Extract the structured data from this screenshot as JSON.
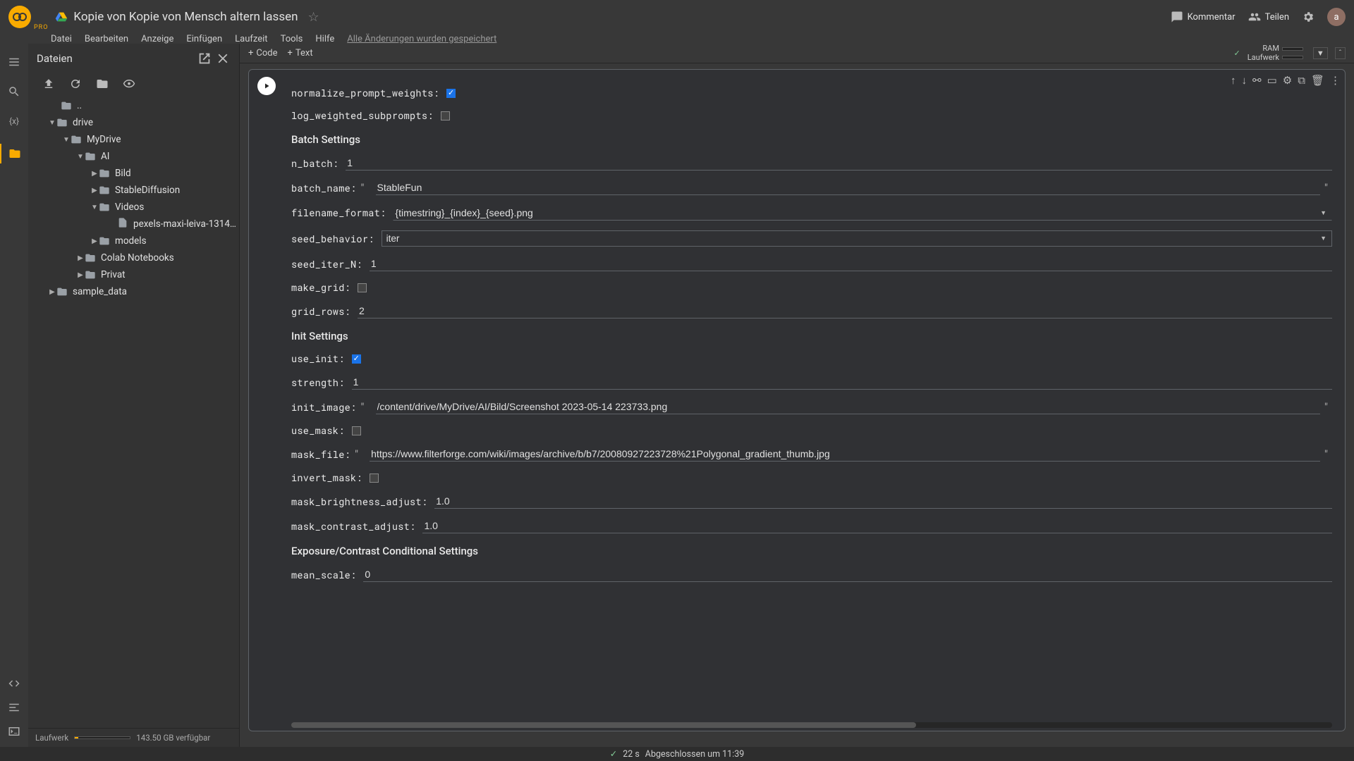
{
  "header": {
    "pro": "PRO",
    "title": "Kopie von Kopie von Mensch altern lassen",
    "comment": "Kommentar",
    "share": "Teilen",
    "avatar": "a"
  },
  "menu": {
    "items": [
      "Datei",
      "Bearbeiten",
      "Anzeige",
      "Einfügen",
      "Laufzeit",
      "Tools",
      "Hilfe"
    ],
    "saved": "Alle Änderungen wurden gespeichert"
  },
  "sidebar": {
    "title": "Dateien",
    "tree": {
      "dots": "..",
      "drive": "drive",
      "mydrive": "MyDrive",
      "ai": "AI",
      "bild": "Bild",
      "sd": "StableDiffusion",
      "videos": "Videos",
      "video_file": "pexels-maxi-leiva-1314…",
      "models": "models",
      "colab": "Colab Notebooks",
      "privat": "Privat",
      "sample": "sample_data"
    },
    "footer_label": "Laufwerk",
    "footer_free": "143.50 GB verfügbar"
  },
  "toolbar": {
    "code": "Code",
    "text": "Text",
    "ram": "RAM",
    "runtime": "Laufwerk"
  },
  "form": {
    "normalize_prompt_weights": {
      "label": "normalize_prompt_weights:",
      "value": true
    },
    "log_weighted_subprompts": {
      "label": "log_weighted_subprompts:",
      "value": false
    },
    "batch_heading": "Batch Settings",
    "n_batch": {
      "label": "n_batch:",
      "value": "1"
    },
    "batch_name": {
      "label": "batch_name:",
      "value": "StableFun"
    },
    "filename_format": {
      "label": "filename_format:",
      "value": "{timestring}_{index}_{seed}.png"
    },
    "seed_behavior": {
      "label": "seed_behavior:",
      "value": "iter"
    },
    "seed_iter_N": {
      "label": "seed_iter_N:",
      "value": "1"
    },
    "make_grid": {
      "label": "make_grid:",
      "value": false
    },
    "grid_rows": {
      "label": "grid_rows:",
      "value": "2"
    },
    "init_heading": "Init Settings",
    "use_init": {
      "label": "use_init:",
      "value": true
    },
    "strength": {
      "label": "strength:",
      "value": "1"
    },
    "init_image": {
      "label": "init_image:",
      "value": "/content/drive/MyDrive/AI/Bild/Screenshot 2023-05-14 223733.png"
    },
    "use_mask": {
      "label": "use_mask:",
      "value": false
    },
    "mask_file": {
      "label": "mask_file:",
      "value": "https://www.filterforge.com/wiki/images/archive/b/b7/20080927223728%21Polygonal_gradient_thumb.jpg"
    },
    "invert_mask": {
      "label": "invert_mask:",
      "value": false
    },
    "mask_brightness_adjust": {
      "label": "mask_brightness_adjust:",
      "value": "1.0"
    },
    "mask_contrast_adjust": {
      "label": "mask_contrast_adjust:",
      "value": "1.0"
    },
    "exposure_heading": "Exposure/Contrast Conditional Settings",
    "mean_scale": {
      "label": "mean_scale:",
      "value": "0"
    }
  },
  "status": {
    "time": "22 s",
    "msg": "Abgeschlossen um 11:39"
  }
}
